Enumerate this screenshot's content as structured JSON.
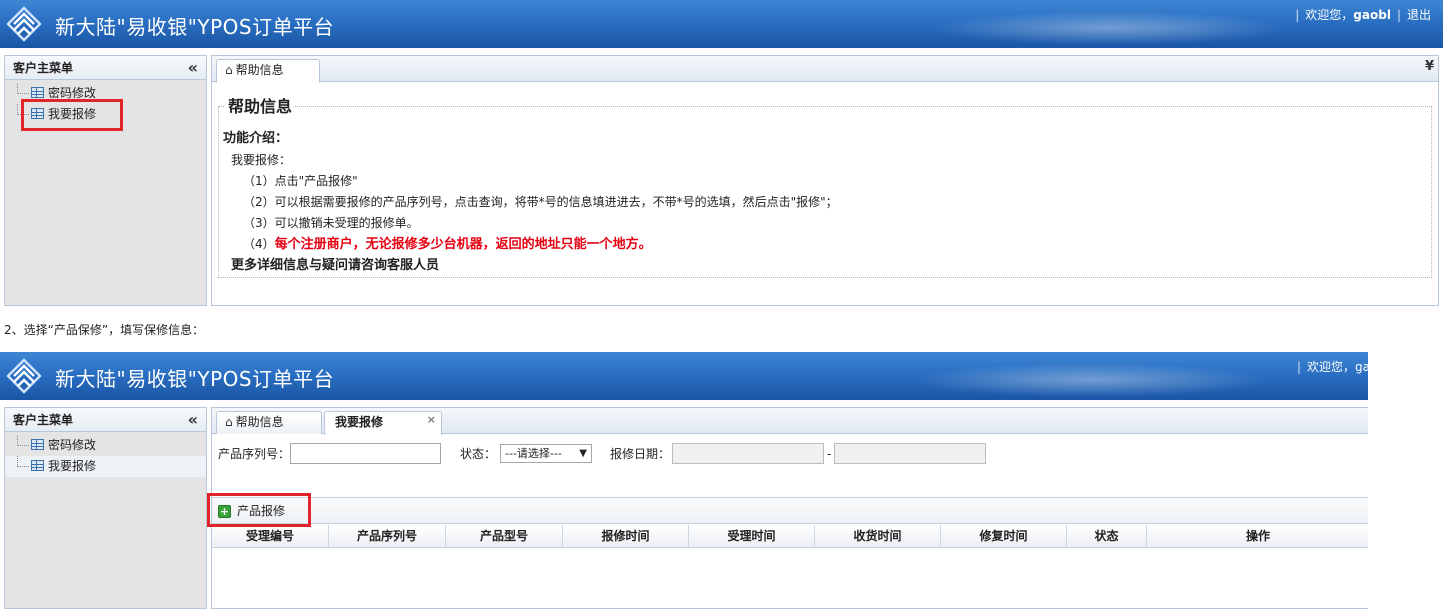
{
  "app": {
    "title": "新大陆\"易收银\"YPOS订单平台",
    "welcome": "欢迎您，",
    "username": "gaobl",
    "logout": "退出",
    "sep": "|",
    "welcome_truncated": "欢迎您，ga"
  },
  "sidebar": {
    "title": "客户主菜单",
    "collapse_glyph": "«",
    "items": [
      {
        "label": "密码修改"
      },
      {
        "label": "我要报修"
      }
    ]
  },
  "screen1": {
    "tabs": [
      {
        "label": "帮助信息"
      }
    ],
    "tab_scroll_glyph": "¥",
    "help": {
      "legend": "帮助信息",
      "heading": "功能介绍：",
      "intro": "我要报修：",
      "steps": [
        "（1）点击\"产品报修\"",
        "（2）可以根据需要报修的产品序列号，点击查询，将带*号的信息填进进去，不带*号的选填，然后点击\"报修\"；",
        "（3）可以撤销未受理的报修单。"
      ],
      "step4_prefix": "（4）",
      "step4_warning": "每个注册商户，无论报修多少台机器，返回的地址只能一个地方。",
      "footer": "更多详细信息与疑问请咨询客服人员"
    }
  },
  "caption": "2、选择“产品保修”，填写保修信息：",
  "screen2": {
    "tabs": [
      {
        "label": "帮助信息"
      },
      {
        "label": "我要报修",
        "close": "×"
      }
    ],
    "search": {
      "serial_label": "产品序列号：",
      "serial_value": "",
      "status_label": "状态：",
      "status_selected": "---请选择---",
      "status_caret": "▼",
      "date_label": "报修日期：",
      "date_sep": "-",
      "date_from": "",
      "date_to": ""
    },
    "toolbar": {
      "add_label": "产品报修",
      "add_icon_glyph": "+"
    },
    "grid": {
      "columns": [
        "受理编号",
        "产品序列号",
        "产品型号",
        "报修时间",
        "受理时间",
        "收货时间",
        "修复时间",
        "状态",
        "操作"
      ],
      "rows": []
    }
  },
  "colors": {
    "banner": "#2a6fc2",
    "annotation": "#e0262a",
    "warning_text": "#e60012",
    "sidebar_bg": "#e4e4e4"
  }
}
